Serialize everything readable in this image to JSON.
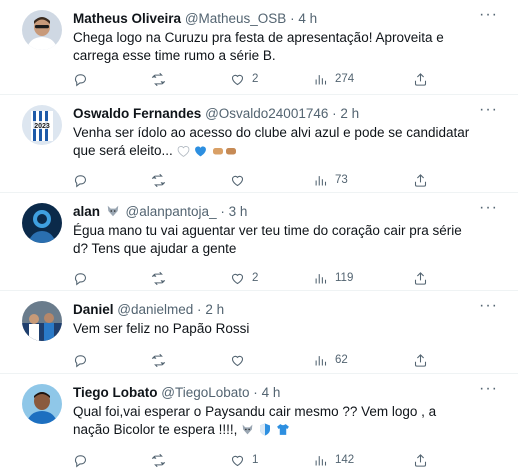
{
  "tweets": [
    {
      "name": "Matheus Oliveira",
      "handle": "@Matheus_OSB",
      "sep": "·",
      "time": "4 h",
      "text": "Chega logo na Curuzu pra festa de apresentação! Aproveita e carrega esse time rumo a série B.",
      "likes": "2",
      "views": "274"
    },
    {
      "name": "Oswaldo Fernandes",
      "handle": "@Osvaldo24001746",
      "sep": "·",
      "time": "2 h",
      "text": "Venha ser ídolo ao acesso do clube alvi azul e pode se candidatar que será eleito...",
      "likes": "",
      "views": "73"
    },
    {
      "name": "alan",
      "handle": "@alanpantoja_",
      "sep": "·",
      "time": "3 h",
      "text": "Égua mano tu vai aguentar ver teu time do coração cair pra série d? Tens que ajudar a gente",
      "likes": "2",
      "views": "119"
    },
    {
      "name": "Daniel",
      "handle": "@danielmed",
      "sep": "·",
      "time": "2 h",
      "text": "Vem ser feliz no Papão Rossi",
      "likes": "",
      "views": "62"
    },
    {
      "name": "Tiego Lobato",
      "handle": "@TiegoLobato",
      "sep": "·",
      "time": "4 h",
      "text": "Qual foi,vai esperar o Paysandu cair mesmo ?? Vem logo , a nação Bicolor te espera !!!!,",
      "likes": "1",
      "views": "142"
    }
  ],
  "icons": [
    "reply-icon",
    "retweet-icon",
    "like-icon",
    "views-icon",
    "share-icon",
    "more-icon"
  ],
  "colors": {
    "text": "#0f1419",
    "muted": "#536471",
    "divider": "#eff3f4",
    "blue": "#1d9bf0"
  }
}
